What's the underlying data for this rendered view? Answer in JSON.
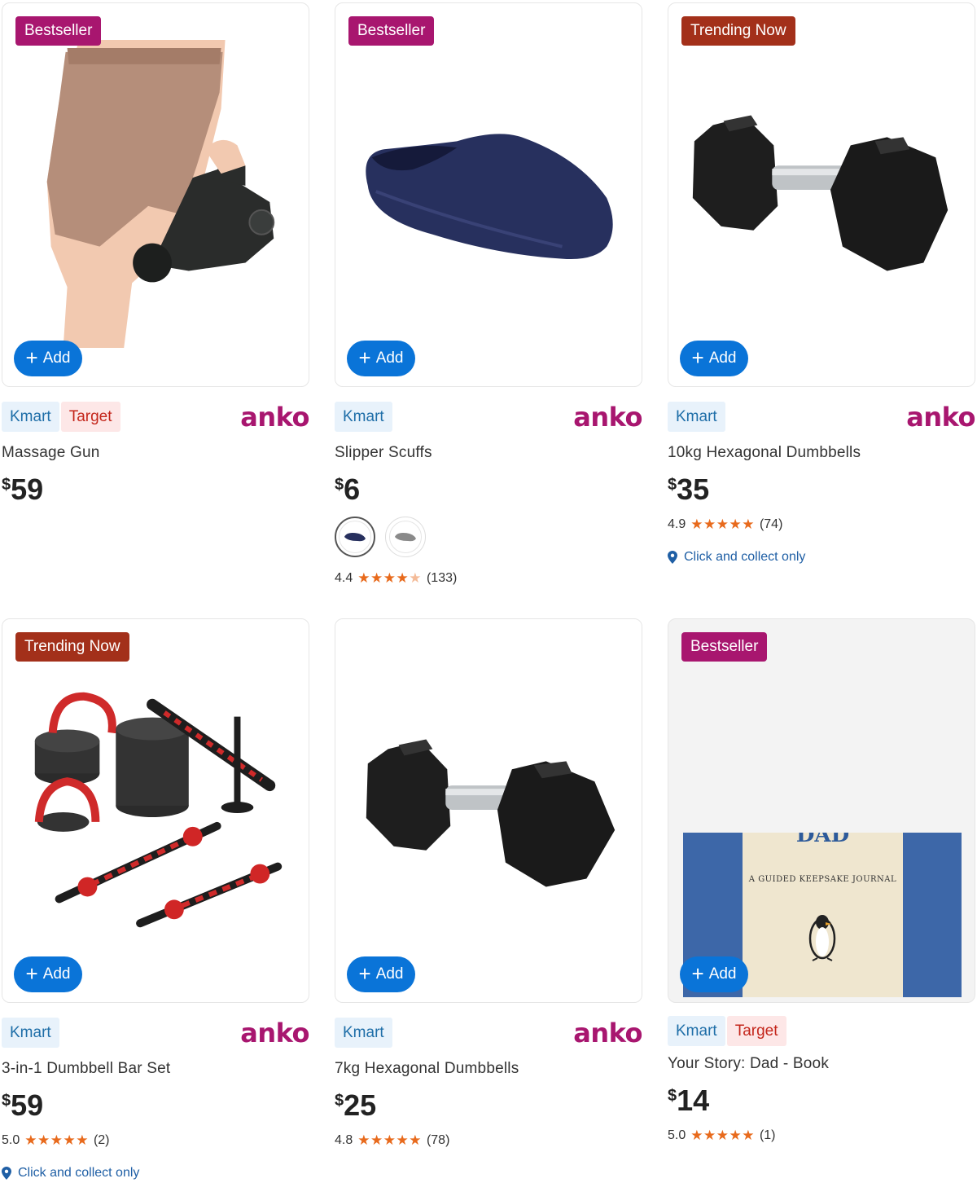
{
  "colors": {
    "bestseller": "#a8166f",
    "trending": "#a3301a",
    "add_button": "#0a74d8",
    "brand": "#a8166f",
    "star": "#e86a1c"
  },
  "products": [
    {
      "badge": "Bestseller",
      "add_label": "Add",
      "retailers": [
        "Kmart",
        "Target"
      ],
      "brand": "anko",
      "name": "Massage Gun",
      "currency": "$",
      "price": "59"
    },
    {
      "badge": "Bestseller",
      "add_label": "Add",
      "retailers": [
        "Kmart"
      ],
      "brand": "anko",
      "name": "Slipper Scuffs",
      "currency": "$",
      "price": "6",
      "swatches": [
        "navy",
        "grey"
      ],
      "rating": "4.4",
      "review_count": "(133)"
    },
    {
      "badge": "Trending Now",
      "add_label": "Add",
      "retailers": [
        "Kmart"
      ],
      "brand": "anko",
      "name": "10kg Hexagonal Dumbbells",
      "currency": "$",
      "price": "35",
      "rating": "4.9",
      "review_count": "(74)",
      "collect_text": "Click and collect only"
    },
    {
      "badge": "Trending Now",
      "add_label": "Add",
      "retailers": [
        "Kmart"
      ],
      "brand": "anko",
      "name": "3-in-1 Dumbbell Bar Set",
      "currency": "$",
      "price": "59",
      "rating": "5.0",
      "review_count": "(2)",
      "collect_text": "Click and collect only"
    },
    {
      "badge": "",
      "add_label": "Add",
      "retailers": [
        "Kmart"
      ],
      "brand": "anko",
      "name": "7kg Hexagonal Dumbbells",
      "currency": "$",
      "price": "25",
      "rating": "4.8",
      "review_count": "(78)"
    },
    {
      "badge": "Bestseller",
      "add_label": "Add",
      "retailers": [
        "Kmart",
        "Target"
      ],
      "brand": "",
      "name": "Your Story: Dad - Book",
      "currency": "$",
      "price": "14",
      "rating": "5.0",
      "review_count": "(1)",
      "book_cover_title": "DAD",
      "book_cover_subtitle": "A GUIDED KEEPSAKE JOURNAL"
    }
  ]
}
